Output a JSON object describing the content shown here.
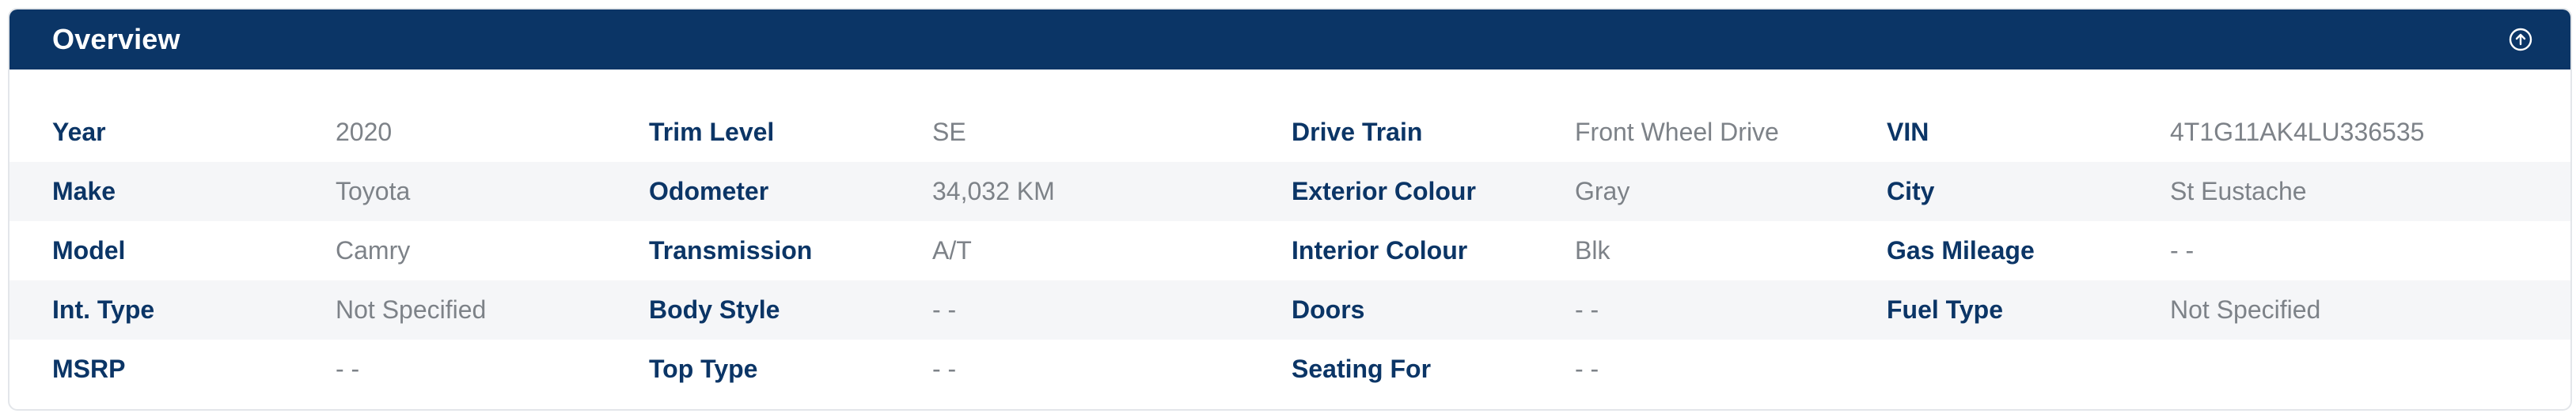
{
  "overview": {
    "title": "Overview",
    "rows": [
      [
        {
          "label": "Year",
          "value": "2020"
        },
        {
          "label": "Trim Level",
          "value": "SE"
        },
        {
          "label": "Drive Train",
          "value": "Front Wheel Drive"
        },
        {
          "label": "VIN",
          "value": "4T1G11AK4LU336535"
        }
      ],
      [
        {
          "label": "Make",
          "value": "Toyota"
        },
        {
          "label": "Odometer",
          "value": "34,032 KM"
        },
        {
          "label": "Exterior Colour",
          "value": "Gray"
        },
        {
          "label": "City",
          "value": "St Eustache"
        }
      ],
      [
        {
          "label": "Model",
          "value": "Camry"
        },
        {
          "label": "Transmission",
          "value": "A/T"
        },
        {
          "label": "Interior Colour",
          "value": "Blk"
        },
        {
          "label": "Gas Mileage",
          "value": "- -"
        }
      ],
      [
        {
          "label": "Int. Type",
          "value": "Not Specified"
        },
        {
          "label": "Body Style",
          "value": "- -"
        },
        {
          "label": "Doors",
          "value": "- -"
        },
        {
          "label": "Fuel Type",
          "value": "Not Specified"
        }
      ],
      [
        {
          "label": "MSRP",
          "value": "- -"
        },
        {
          "label": "Top Type",
          "value": "- -"
        },
        {
          "label": "Seating For",
          "value": "- -"
        }
      ]
    ]
  },
  "icons": {
    "collapse": "arrow-up-circle-icon"
  },
  "colors": {
    "header_bg": "#0b3566",
    "label": "#0b3566",
    "value": "#7d8288",
    "stripe": "#f5f6f8"
  }
}
